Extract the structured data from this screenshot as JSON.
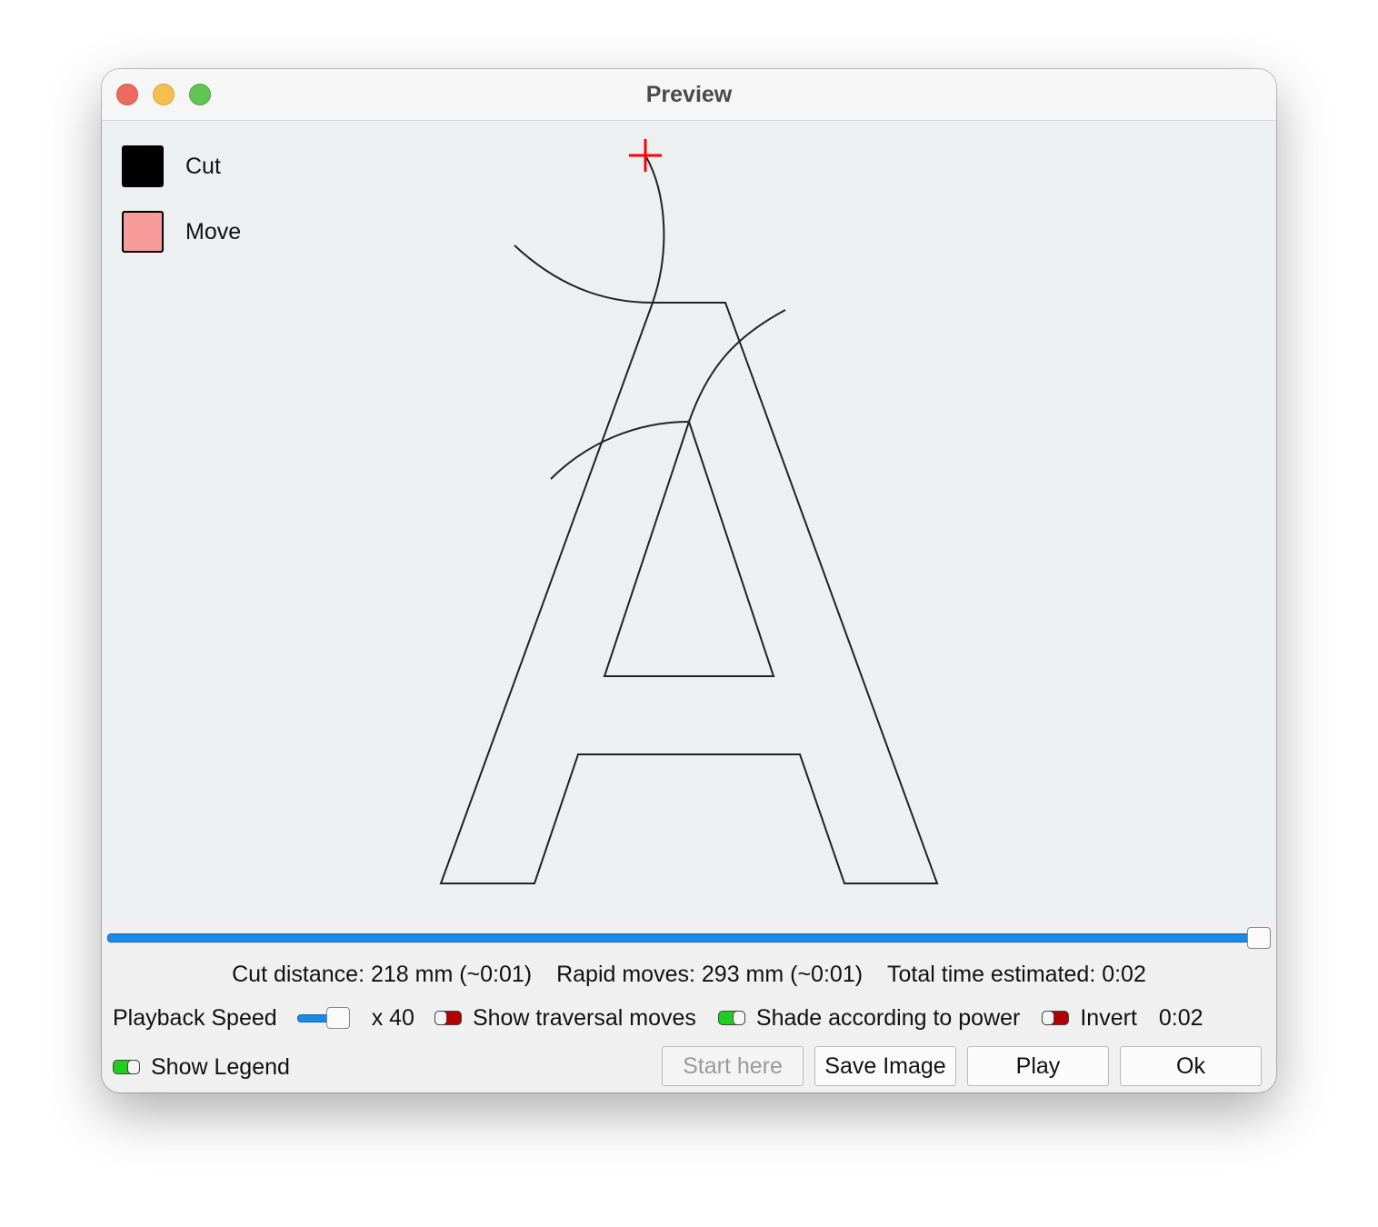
{
  "window": {
    "title": "Preview"
  },
  "legend": {
    "items": [
      {
        "label": "Cut",
        "color": "#000000"
      },
      {
        "label": "Move",
        "color": "#f89b9b"
      }
    ]
  },
  "stats": {
    "cut_distance": "Cut distance: 218 mm (~0:01)",
    "rapid_moves": "Rapid moves: 293 mm (~0:01)",
    "total_time": "Total time estimated: 0:02"
  },
  "playback": {
    "progress_fraction": 1.0
  },
  "controls": {
    "speed_label": "Playback Speed",
    "speed_value": "x 40",
    "show_traversal_label": "Show traversal moves",
    "show_traversal_on": false,
    "shade_label": "Shade according to power",
    "shade_on": true,
    "invert_label": "Invert",
    "invert_on": false,
    "time_display": "0:02",
    "show_legend_label": "Show Legend",
    "show_legend_on": true
  },
  "buttons": {
    "start_here": "Start here",
    "save_image": "Save Image",
    "play": "Play",
    "ok": "Ok"
  },
  "colors": {
    "accent": "#1a8ae6",
    "toggle_on": "#1fcf1f",
    "toggle_off": "#b00000",
    "cursor": "#ff0000",
    "canvas_bg": "#ecf0f1"
  }
}
